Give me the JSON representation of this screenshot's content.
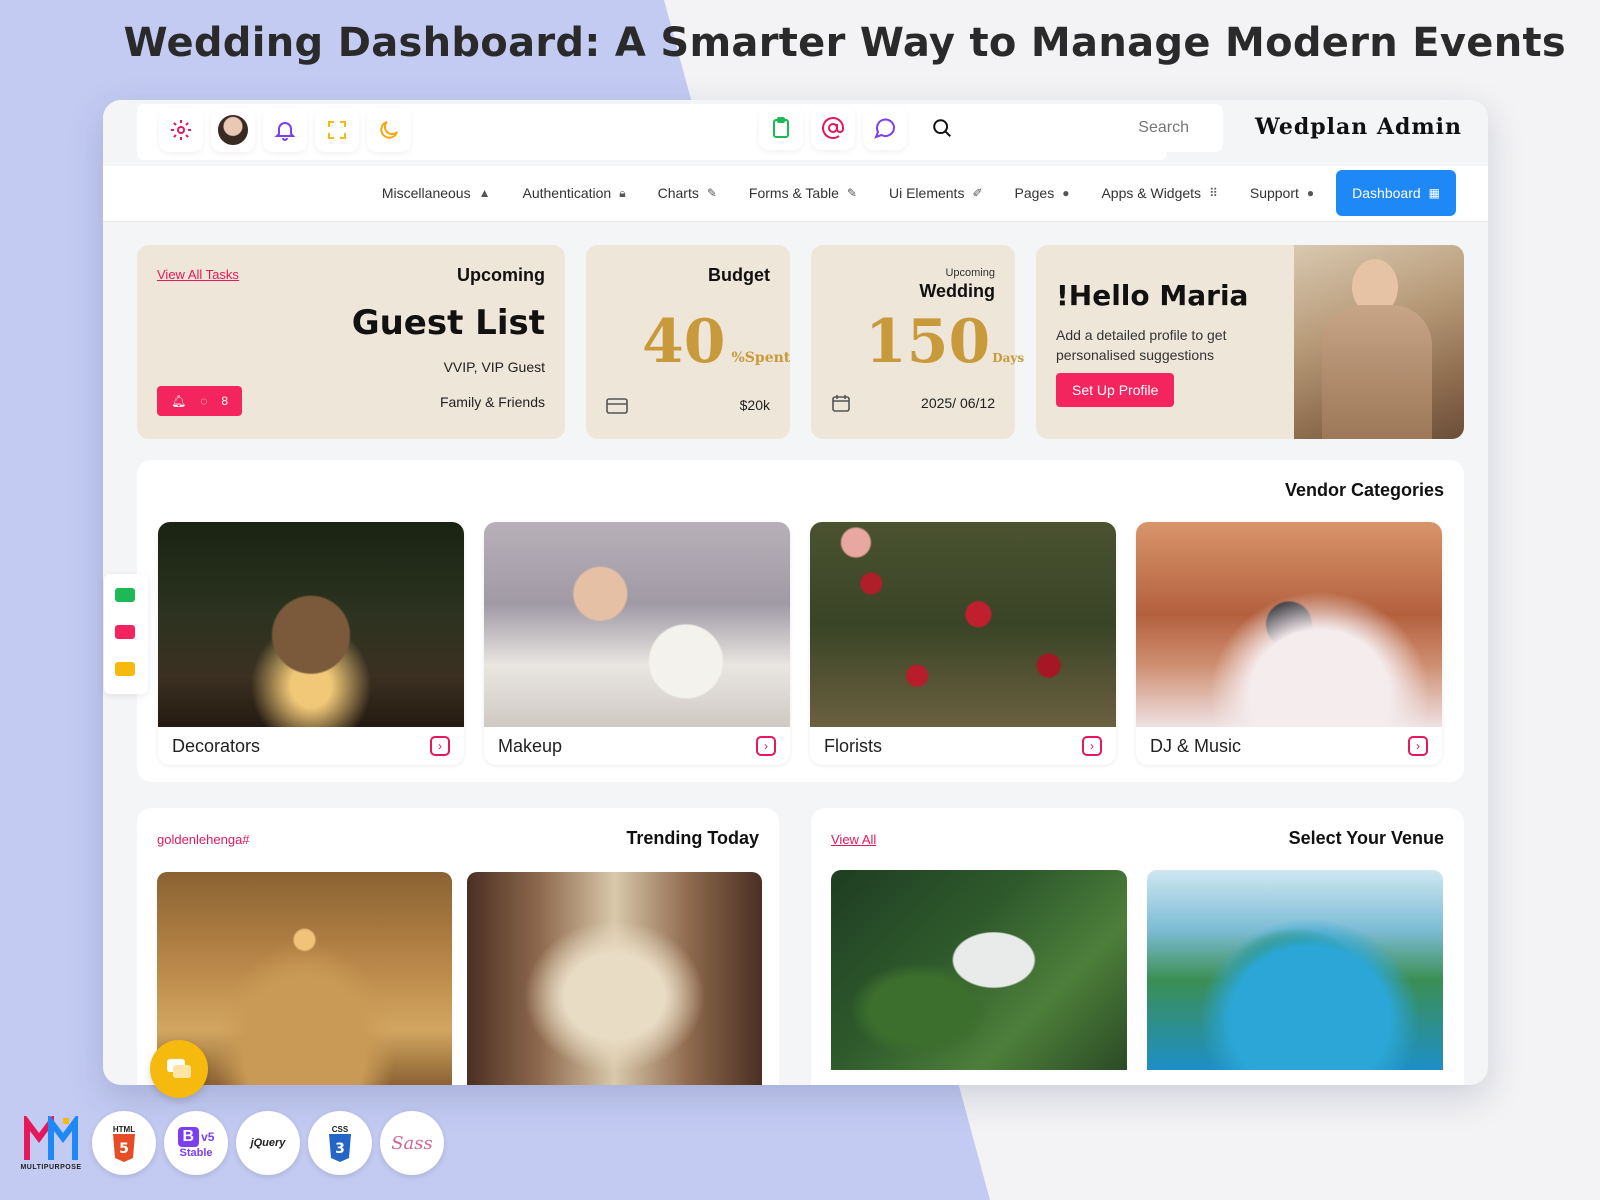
{
  "headline": "Wedding Dashboard: A Smarter Way to Manage Modern Events",
  "brand": "Wedplan Admin",
  "search": {
    "placeholder": "Search"
  },
  "nav": [
    {
      "label": "Miscellaneous",
      "icon": "warning-icon"
    },
    {
      "label": "Authentication",
      "icon": "lock-icon"
    },
    {
      "label": "Charts",
      "icon": "pin-icon"
    },
    {
      "label": "Forms & Table",
      "icon": "pin-icon"
    },
    {
      "label": "Ui Elements",
      "icon": "edit-icon"
    },
    {
      "label": "Pages",
      "icon": "user-icon"
    },
    {
      "label": "Apps & Widgets",
      "icon": "grid-icon"
    },
    {
      "label": "Support",
      "icon": "chat-bubble-icon"
    },
    {
      "label": "Dashboard",
      "icon": "dashboard-icon",
      "active": true
    }
  ],
  "guest_card": {
    "link": "View All Tasks",
    "eyebrow": "Upcoming",
    "title": "Guest List",
    "line1": "VVIP, VIP Guest",
    "line2": "Family & Friends",
    "comment_count": "8"
  },
  "budget_card": {
    "title": "Budget",
    "value": "40",
    "suffix": "%Spent",
    "amount": "$20k"
  },
  "wedding_card": {
    "eyebrow": "Upcoming",
    "title": "Wedding",
    "value": "150",
    "suffix": "Days",
    "date": "2025/ 06/12"
  },
  "hello_card": {
    "title": "!Hello Maria",
    "text": "Add a detailed profile to get personalised suggestions",
    "button": "Set Up Profile"
  },
  "vendors": {
    "title": "Vendor Categories",
    "items": [
      {
        "label": "Decorators"
      },
      {
        "label": "Makeup"
      },
      {
        "label": "Florists"
      },
      {
        "label": "DJ & Music"
      }
    ]
  },
  "trending": {
    "tag": "goldenlehenga#",
    "title": "Trending Today"
  },
  "venue": {
    "link": "View All",
    "title": "Select Your Venue"
  },
  "tech_badges": [
    "HTML",
    "v5",
    "Stable",
    "jQuery",
    "CSS",
    "Sass"
  ],
  "logo_text": "MULTIPURPOSE"
}
